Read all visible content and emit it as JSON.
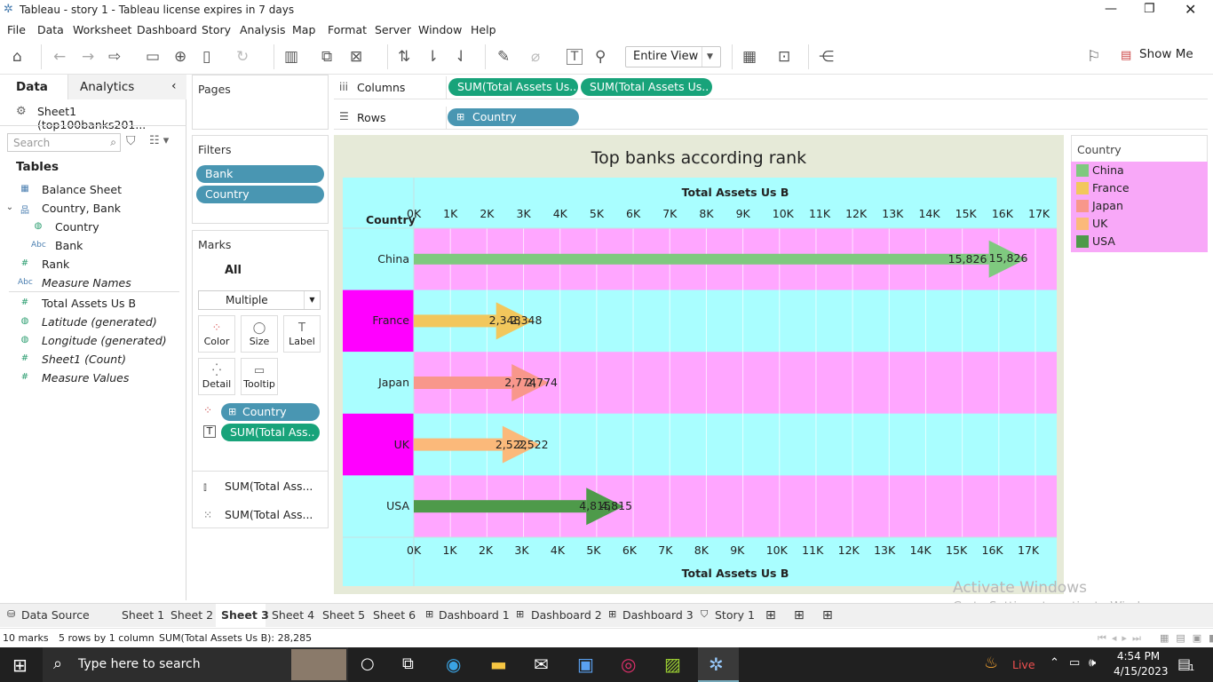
{
  "window": {
    "title": "Tableau - story 1 - Tableau license expires in 7 days"
  },
  "menu": [
    "File",
    "Data",
    "Worksheet",
    "Dashboard",
    "Story",
    "Analysis",
    "Map",
    "Format",
    "Server",
    "Window",
    "Help"
  ],
  "toolbar": {
    "view_mode": "Entire View",
    "show_me": "Show Me"
  },
  "data_pane": {
    "tabs": {
      "data": "Data",
      "analytics": "Analytics"
    },
    "datasource": "Sheet1 (top100banks201...",
    "search_placeholder": "Search",
    "tables_heading": "Tables",
    "fields": [
      {
        "label": "Balance Sheet",
        "icon": "calendar-icon"
      },
      {
        "label": "Country, Bank",
        "icon": "hierarchy-icon"
      },
      {
        "label": "Country",
        "icon": "globe-icon"
      },
      {
        "label": "Bank",
        "icon": "abc-icon"
      },
      {
        "label": "Rank",
        "icon": "hash-icon"
      },
      {
        "label": "Measure Names",
        "icon": "abc-icon"
      },
      {
        "label": "Total Assets Us B",
        "icon": "hash-icon"
      },
      {
        "label": "Latitude (generated)",
        "icon": "globe-icon"
      },
      {
        "label": "Longitude (generated)",
        "icon": "globe-icon"
      },
      {
        "label": "Sheet1 (Count)",
        "icon": "hash-icon"
      },
      {
        "label": "Measure Values",
        "icon": "hash-icon"
      }
    ]
  },
  "pages": {
    "title": "Pages"
  },
  "filters": {
    "title": "Filters",
    "items": [
      "Bank",
      "Country"
    ]
  },
  "marks": {
    "title": "Marks",
    "all": "All",
    "type": "Multiple",
    "buttons": [
      "Color",
      "Size",
      "Label",
      "Detail",
      "Tooltip"
    ],
    "pills": [
      "Country",
      "SUM(Total Ass.."
    ],
    "measures": [
      "SUM(Total Ass...",
      "SUM(Total Ass..."
    ]
  },
  "shelves": {
    "columns_label": "Columns",
    "rows_label": "Rows",
    "columns": [
      "SUM(Total Assets Us..",
      "SUM(Total Assets Us.."
    ],
    "rows": [
      "Country"
    ]
  },
  "legend": {
    "title": "Country",
    "items": [
      {
        "label": "China",
        "color": "#7fc97f"
      },
      {
        "label": "France",
        "color": "#f2c75c"
      },
      {
        "label": "Japan",
        "color": "#f8978b"
      },
      {
        "label": "UK",
        "color": "#fbb97a"
      },
      {
        "label": "USA",
        "color": "#4e9a4a"
      }
    ]
  },
  "chart_data": {
    "type": "bar",
    "title": "Top banks according rank",
    "row_header": "Country",
    "xlabel": "Total Assets Us B",
    "xlim": [
      0,
      17000
    ],
    "x_ticks": [
      "0K",
      "1K",
      "2K",
      "3K",
      "4K",
      "5K",
      "6K",
      "7K",
      "8K",
      "9K",
      "10K",
      "11K",
      "12K",
      "13K",
      "14K",
      "15K",
      "16K",
      "17K"
    ],
    "bottom_x_ticks": [
      "0K",
      "1K",
      "2K",
      "3K",
      "4K",
      "5K",
      "6K",
      "7K",
      "8K",
      "9K",
      "10K",
      "11K",
      "12K",
      "13K",
      "14K",
      "15K",
      "16K",
      "17K"
    ],
    "categories": [
      "China",
      "France",
      "Japan",
      "UK",
      "USA"
    ],
    "values": [
      15826,
      2348,
      2774,
      2522,
      4815
    ],
    "value_labels": [
      "15,826",
      "2,348",
      "2,774",
      "2,522",
      "4,815"
    ],
    "colors": [
      "#7fc97f",
      "#f2c75c",
      "#f8978b",
      "#fbb97a",
      "#4e9a4a"
    ]
  },
  "sheet_tabs": [
    "Data Source",
    "Sheet 1",
    "Sheet 2",
    "Sheet 3",
    "Sheet 4",
    "Sheet 5",
    "Sheet 6",
    "Dashboard 1",
    "Dashboard 2",
    "Dashboard 3",
    "Story 1"
  ],
  "active_tab": "Sheet 3",
  "status": {
    "marks": "10 marks",
    "rows": "5 rows by 1 column",
    "sum": "SUM(Total Assets Us B): 28,285"
  },
  "watermark": {
    "line1": "Activate Windows",
    "line2": "Go to Settings to activate Windows."
  },
  "taskbar": {
    "search_placeholder": "Type here to search",
    "weather": "Live",
    "time": "4:54 PM",
    "date": "4/15/2023",
    "notifications": "1"
  }
}
